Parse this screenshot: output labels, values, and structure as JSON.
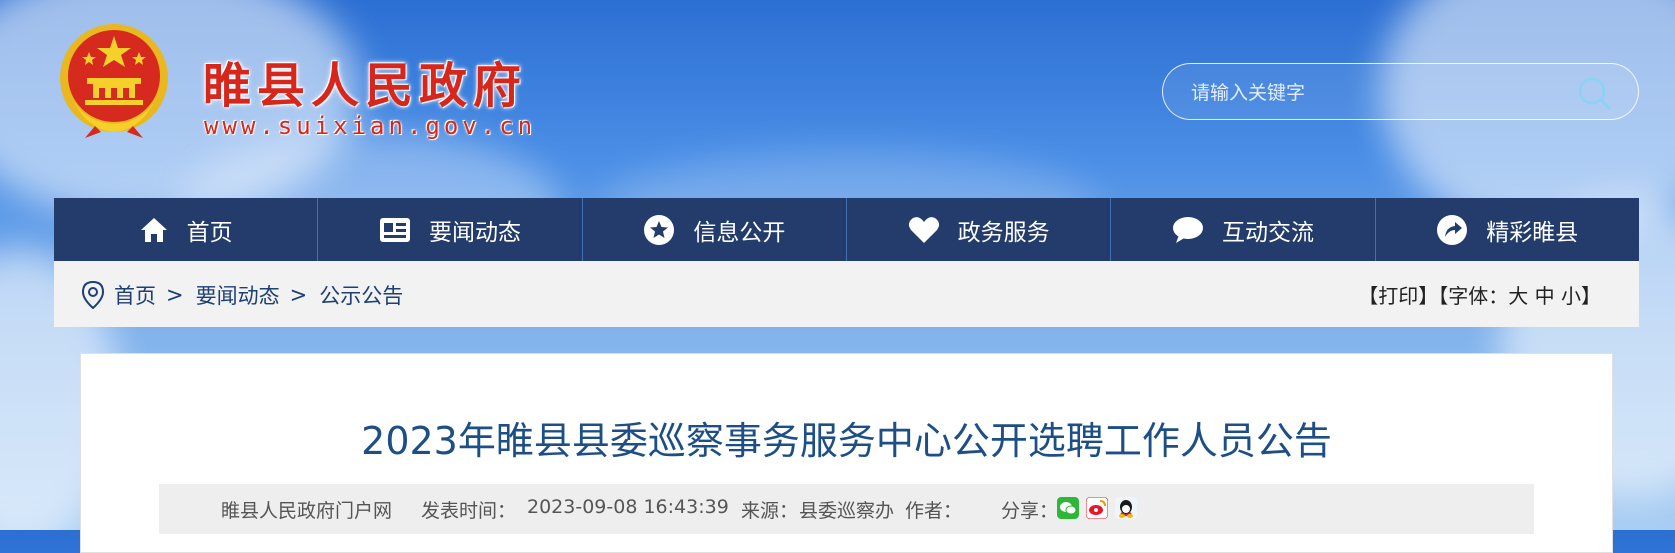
{
  "header": {
    "site_title": "睢县人民政府",
    "site_url": "www.suixian.gov.cn",
    "search_placeholder": "请输入关键字"
  },
  "nav": [
    {
      "label": "首页",
      "icon": "home-icon"
    },
    {
      "label": "要闻动态",
      "icon": "news-card-icon"
    },
    {
      "label": "信息公开",
      "icon": "star-circle-icon"
    },
    {
      "label": "政务服务",
      "icon": "heart-icon"
    },
    {
      "label": "互动交流",
      "icon": "chat-bubble-icon"
    },
    {
      "label": "精彩睢县",
      "icon": "arrow-circle-icon"
    }
  ],
  "breadcrumb": {
    "items": [
      "首页",
      "要闻动态",
      "公示公告"
    ],
    "separator": ">"
  },
  "tools": {
    "print": "【打印】",
    "font_prefix": "【字体：",
    "large": "大",
    "medium": "中",
    "small": "小",
    "font_suffix": "】"
  },
  "article": {
    "title": "2023年睢县县委巡察事务服务中心公开选聘工作人员公告",
    "site": "睢县人民政府门户网",
    "publish_label": "发表时间：",
    "publish_time": "2023-09-08 16:43:39",
    "source_label": "来源：",
    "source": "县委巡察办",
    "author_label": "作者：",
    "share_label": "分享："
  },
  "colors": {
    "nav_bg": "#233c6b",
    "title_red": "#d7261c",
    "article_title": "#1d4f86",
    "wechat": "#2fb538",
    "weibo": "#e6162d",
    "qq": "#1296db"
  }
}
